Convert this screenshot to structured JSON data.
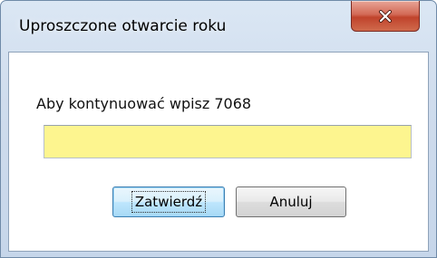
{
  "window": {
    "title": "Uproszczone otwarcie roku",
    "close_icon": "close-icon"
  },
  "dialog": {
    "prompt": "Aby kontynuować wpisz 7068",
    "input_value": "",
    "input_placeholder": "",
    "ok_label": "Zatwierdź",
    "cancel_label": "Anuluj"
  },
  "colors": {
    "input_background": "#fdf58f",
    "close_button": "#c7503a",
    "default_button_border": "#3c7fb1"
  }
}
